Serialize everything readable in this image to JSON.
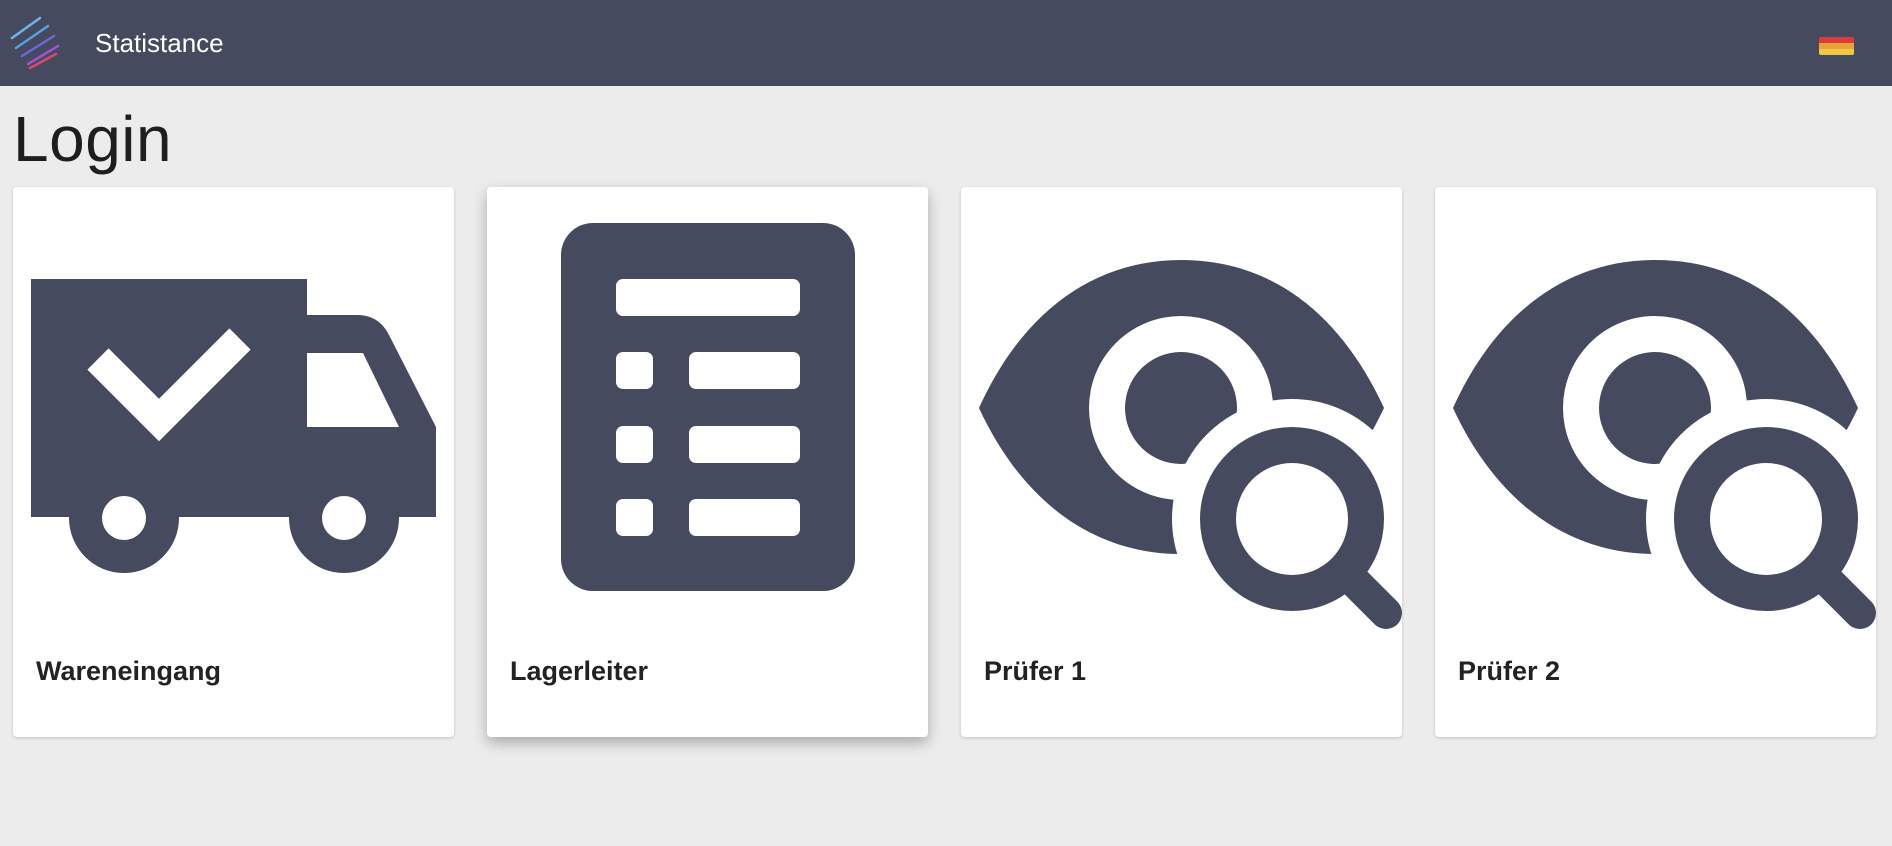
{
  "header": {
    "app_name": "Statistance",
    "logo_icon": "statistance-logo-icon",
    "language_icon": "german-flag-icon",
    "flag_colors": [
      "#dd3b3b",
      "#e8a339",
      "#f0c942"
    ]
  },
  "page": {
    "title": "Login"
  },
  "roles": [
    {
      "label": "Wareneingang",
      "icon": "delivery-truck-check-icon"
    },
    {
      "label": "Lagerleiter",
      "icon": "checklist-icon"
    },
    {
      "label": "Prüfer 1",
      "icon": "eye-search-icon"
    },
    {
      "label": "Prüfer 2",
      "icon": "eye-search-icon"
    }
  ],
  "colors": {
    "header_bg": "#454a5e",
    "icon": "#454a5e",
    "page_bg": "#ececec"
  }
}
